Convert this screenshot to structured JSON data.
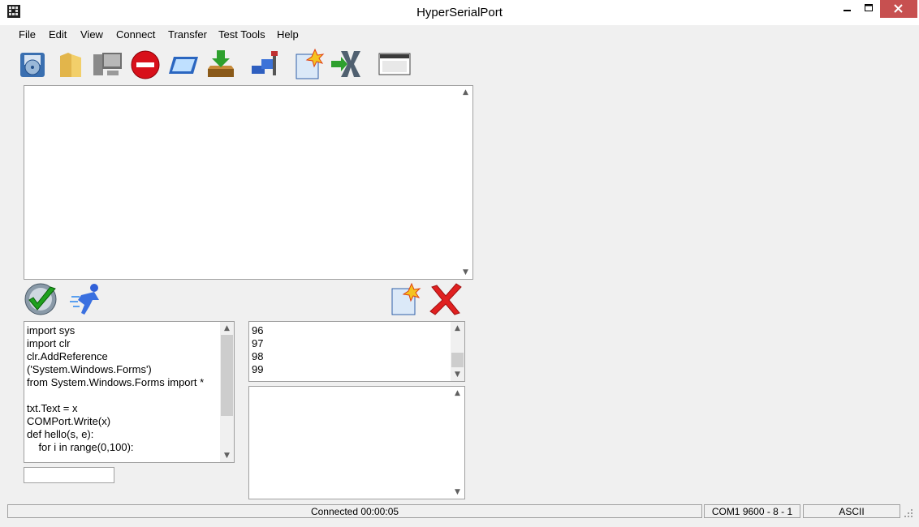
{
  "window": {
    "title": "HyperSerialPort"
  },
  "menu": [
    "File",
    "Edit",
    "View",
    "Connect",
    "Transfer",
    "Test Tools",
    "Help"
  ],
  "toolbar_icons": [
    "disk-icon",
    "folder-icon",
    "computer-icon",
    "stop-icon",
    "window-icon",
    "download-icon",
    "tools-icon",
    "new-document-icon",
    "hex-icon",
    "terminal-icon"
  ],
  "script_lines": [
    "import sys",
    "import clr",
    "clr.AddReference",
    "('System.Windows.Forms')",
    "from System.Windows.Forms import *",
    "",
    "txt.Text = x",
    "COMPort.Write(x)",
    "def hello(s, e):",
    "    for i in range(0,100):"
  ],
  "output_lines": [
    "96",
    "97",
    "98",
    "99"
  ],
  "small_input_value": "",
  "status": {
    "connection": "Connected 00:00:05",
    "port": "COM1  9600 - 8 - 1",
    "mode": "ASCII"
  }
}
